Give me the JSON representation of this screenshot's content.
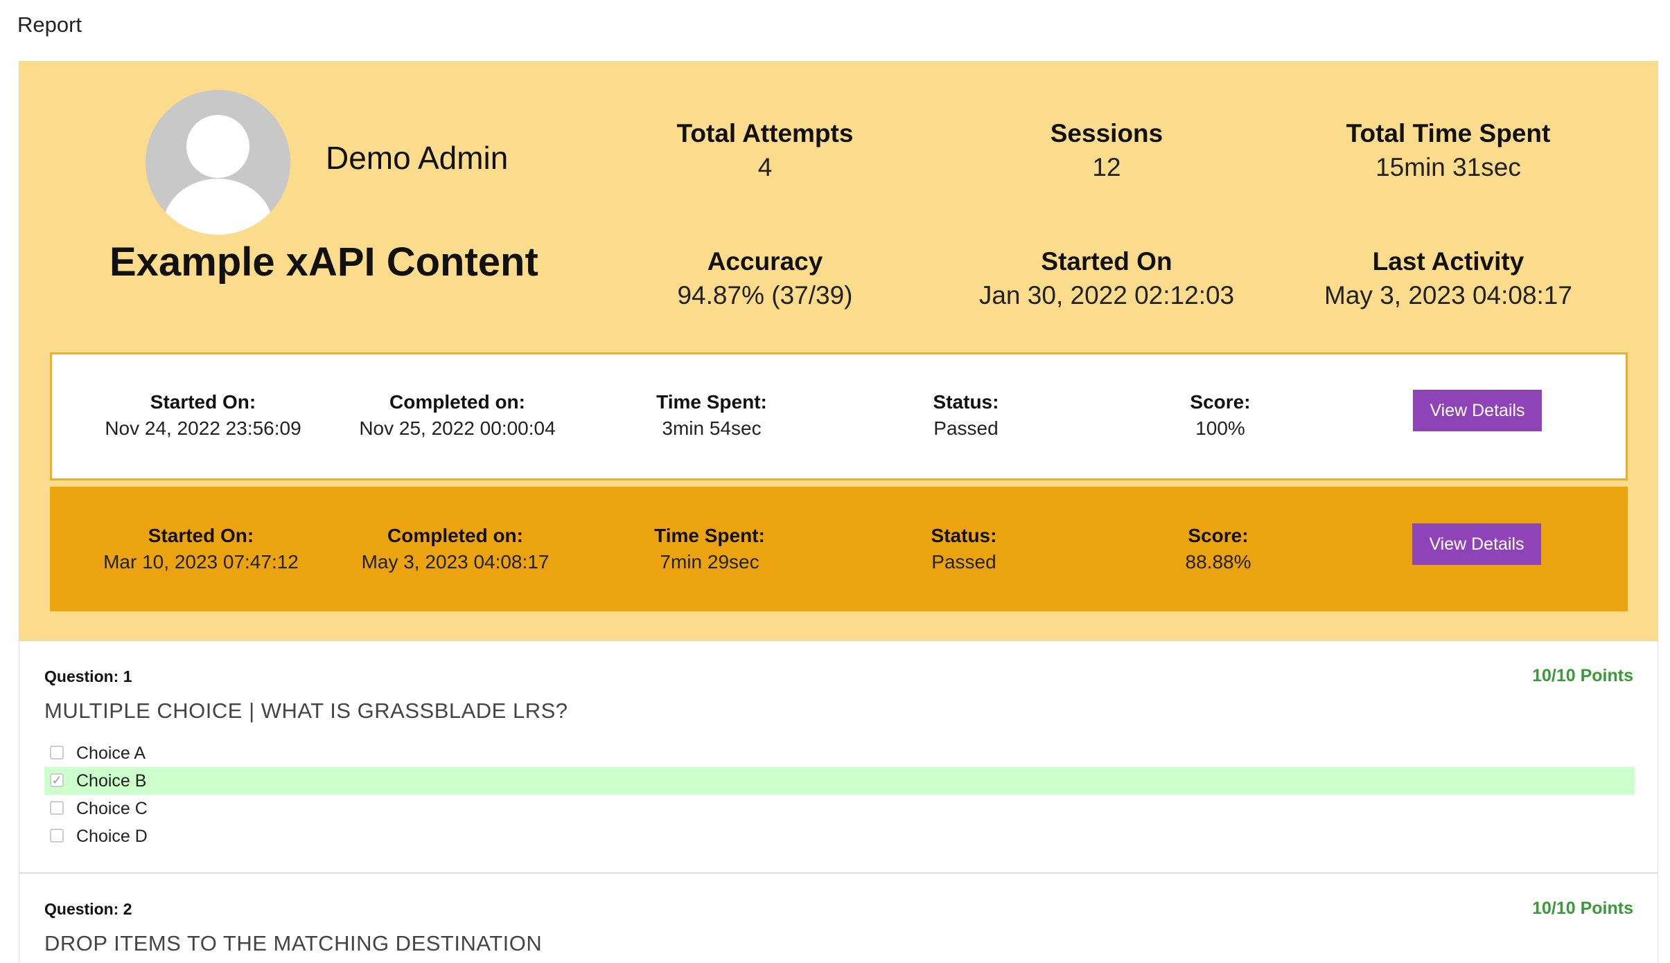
{
  "page": {
    "title": "Report"
  },
  "profile": {
    "name": "Demo Admin",
    "content_title": "Example xAPI Content"
  },
  "stats": [
    {
      "label": "Total Attempts",
      "value": "4"
    },
    {
      "label": "Sessions",
      "value": "12"
    },
    {
      "label": "Total Time Spent",
      "value": "15min 31sec"
    },
    {
      "label": "Accuracy",
      "value": "94.87% (37/39)"
    },
    {
      "label": "Started On",
      "value": "Jan 30, 2022 02:12:03"
    },
    {
      "label": "Last Activity",
      "value": "May 3, 2023 04:08:17"
    }
  ],
  "attempt_labels": {
    "started": "Started On:",
    "completed": "Completed on:",
    "time": "Time Spent:",
    "status": "Status:",
    "score": "Score:",
    "button": "View Details"
  },
  "attempts": [
    {
      "started": "Nov 24, 2022 23:56:09",
      "completed": "Nov 25, 2022 00:00:04",
      "time": "3min 54sec",
      "status": "Passed",
      "score": "100%"
    },
    {
      "started": "Mar 10, 2023 07:47:12",
      "completed": "May 3, 2023 04:08:17",
      "time": "7min 29sec",
      "status": "Passed",
      "score": "88.88%"
    }
  ],
  "questions": [
    {
      "number": "Question: 1",
      "points": "10/10 Points",
      "text": "MULTIPLE CHOICE | WHAT IS GRASSBLADE LRS?",
      "choices": [
        {
          "label": "Choice A",
          "checked": false
        },
        {
          "label": "Choice B",
          "checked": true
        },
        {
          "label": "Choice C",
          "checked": false
        },
        {
          "label": "Choice D",
          "checked": false
        }
      ]
    },
    {
      "number": "Question: 2",
      "points": "10/10 Points",
      "text": "DROP ITEMS TO THE MATCHING DESTINATION"
    }
  ],
  "colors": {
    "summary_bg": "#fbdb8c",
    "selected_attempt_bg": "#eba40f",
    "button_bg": "#8e44b6",
    "points_green": "#3a9a3a",
    "correct_bg": "#ccffcc"
  }
}
